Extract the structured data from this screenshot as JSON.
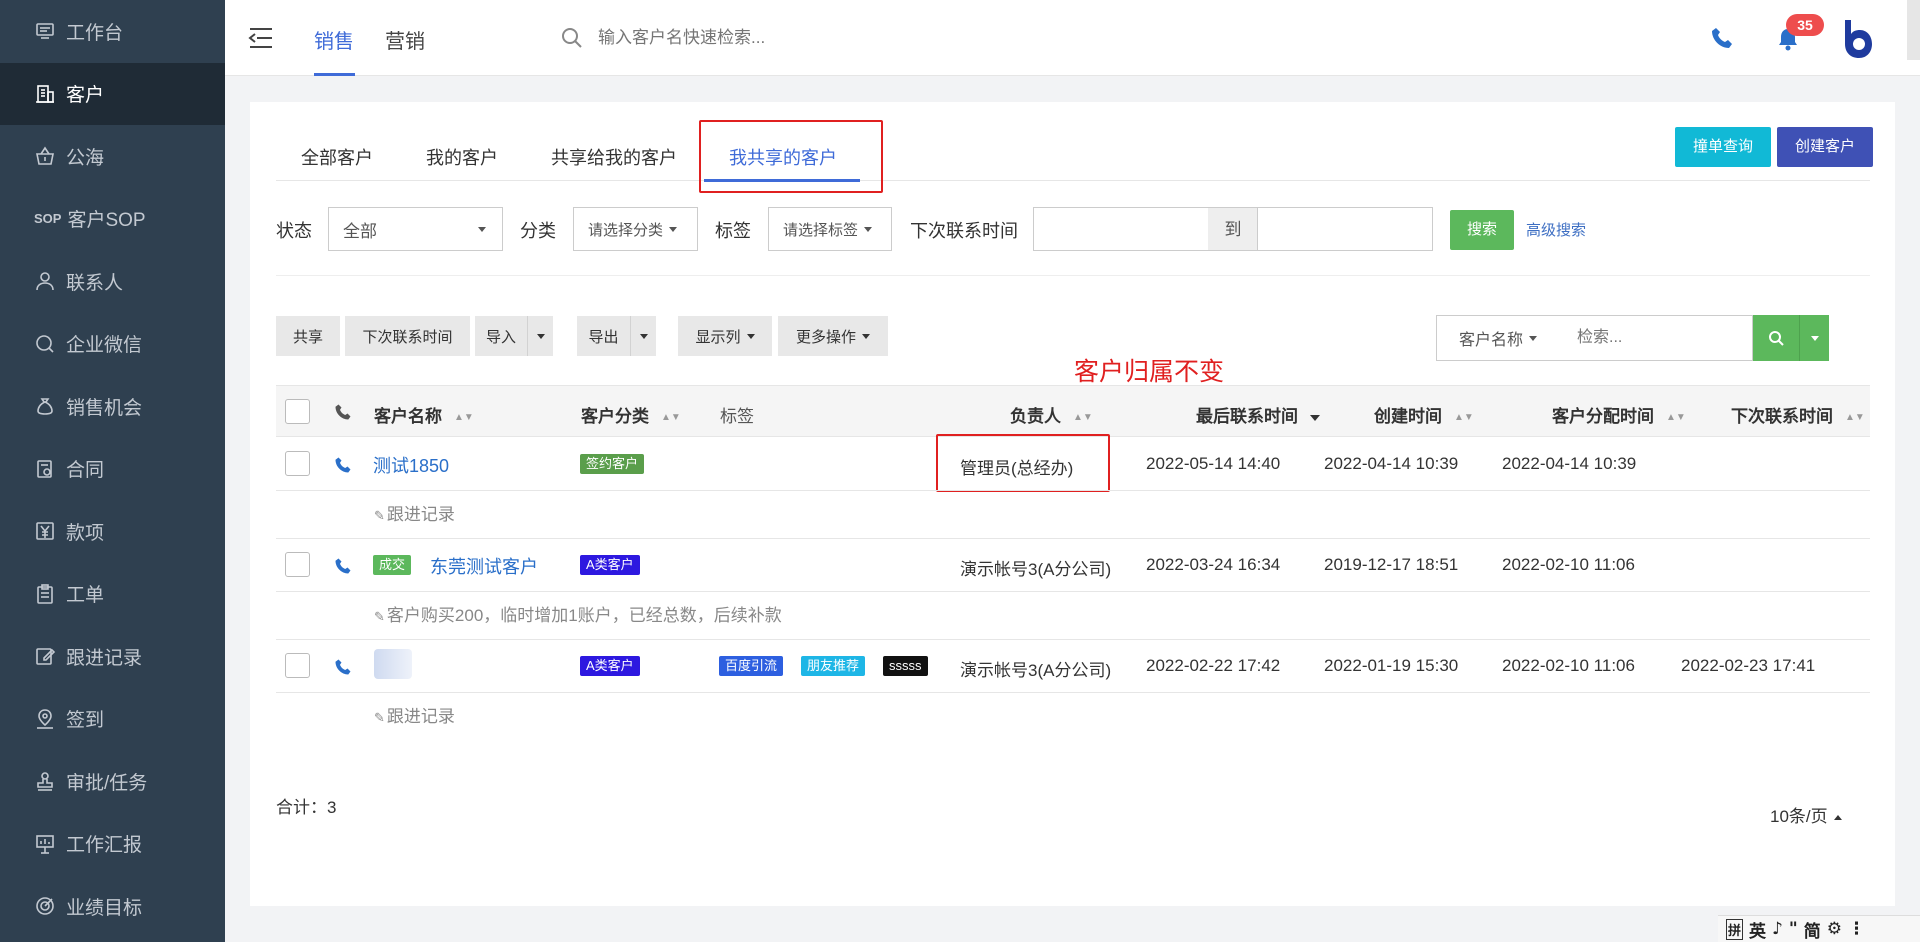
{
  "sidebar": {
    "items": [
      {
        "label": "工作台",
        "icon": "dashboard-icon"
      },
      {
        "label": "客户",
        "icon": "building-icon",
        "active": true
      },
      {
        "label": "公海",
        "icon": "basket-icon"
      },
      {
        "label": "客户SOP",
        "icon": "sop-icon"
      },
      {
        "label": "联系人",
        "icon": "person-icon"
      },
      {
        "label": "企业微信",
        "icon": "chat-icon"
      },
      {
        "label": "销售机会",
        "icon": "money-bag-icon"
      },
      {
        "label": "合同",
        "icon": "contract-icon"
      },
      {
        "label": "款项",
        "icon": "yen-icon"
      },
      {
        "label": "工单",
        "icon": "clipboard-icon"
      },
      {
        "label": "跟进记录",
        "icon": "edit-icon"
      },
      {
        "label": "签到",
        "icon": "location-pin-icon"
      },
      {
        "label": "审批/任务",
        "icon": "stamp-icon"
      },
      {
        "label": "工作汇报",
        "icon": "presentation-icon"
      },
      {
        "label": "业绩目标",
        "icon": "target-icon"
      }
    ]
  },
  "header": {
    "tabs": [
      {
        "label": "销售",
        "active": true
      },
      {
        "label": "营销"
      }
    ],
    "search_placeholder": "输入客户名快速检索...",
    "notification_count": "35"
  },
  "subtabs": [
    {
      "label": "全部客户"
    },
    {
      "label": "我的客户"
    },
    {
      "label": "共享给我的客户"
    },
    {
      "label": "我共享的客户",
      "active": true
    }
  ],
  "actions": {
    "check_label": "撞单查询",
    "create_label": "创建客户"
  },
  "filters": {
    "status_label": "状态",
    "status_value": "全部",
    "category_label": "分类",
    "category_placeholder": "请选择分类",
    "tag_label": "标签",
    "tag_placeholder": "请选择标签",
    "next_contact_label": "下次联系时间",
    "to_label": "到",
    "search_label": "搜索",
    "advanced_label": "高级搜索"
  },
  "toolbar": {
    "share": "共享",
    "next_contact": "下次联系时间",
    "import": "导入",
    "export": "导出",
    "columns": "显示列",
    "more": "更多操作",
    "field_select": "客户名称",
    "search_placeholder": "检索..."
  },
  "annotation": "客户归属不变",
  "table": {
    "headers": {
      "name": "客户名称",
      "category": "客户分类",
      "tags": "标签",
      "owner": "负责人",
      "last_contact": "最后联系时间",
      "created": "创建时间",
      "assigned": "客户分配时间",
      "next_contact": "下次联系时间"
    },
    "rows": [
      {
        "name": "测试1850",
        "category": "签约客户",
        "category_color": "#5a9e4b",
        "owner": "管理员(总经办)",
        "last_contact": "2022-05-14 14:40",
        "created": "2022-04-14 10:39",
        "assigned": "2022-04-14 10:39",
        "next_contact": "",
        "note": "跟进记录"
      },
      {
        "badge": "成交",
        "name": "东莞测试客户",
        "category": "A类客户",
        "category_color": "#2d18e0",
        "owner": "演示帐号3(A分公司)",
        "last_contact": "2022-03-24 16:34",
        "created": "2019-12-17 18:51",
        "assigned": "2022-02-10 11:06",
        "next_contact": "",
        "note": "客户购买200，临时增加1账户，已经总数，后续补款"
      },
      {
        "name": "",
        "category": "A类客户",
        "category_color": "#2d18e0",
        "tags": [
          {
            "label": "百度引流",
            "color": "#2d5fe0"
          },
          {
            "label": "朋友推荐",
            "color": "#1eb6e6"
          },
          {
            "label": "sssss",
            "color": "#111111"
          }
        ],
        "owner": "演示帐号3(A分公司)",
        "last_contact": "2022-02-22 17:42",
        "created": "2022-01-19 15:30",
        "assigned": "2022-02-10 11:06",
        "next_contact": "2022-02-23 17:41",
        "note": "跟进记录"
      }
    ]
  },
  "footer": {
    "total": "合计：3",
    "page_size": "10条/页"
  },
  "ime": {
    "items": [
      "拼",
      "英",
      "♪",
      "\"",
      "简",
      "⚙",
      "⋮"
    ]
  }
}
